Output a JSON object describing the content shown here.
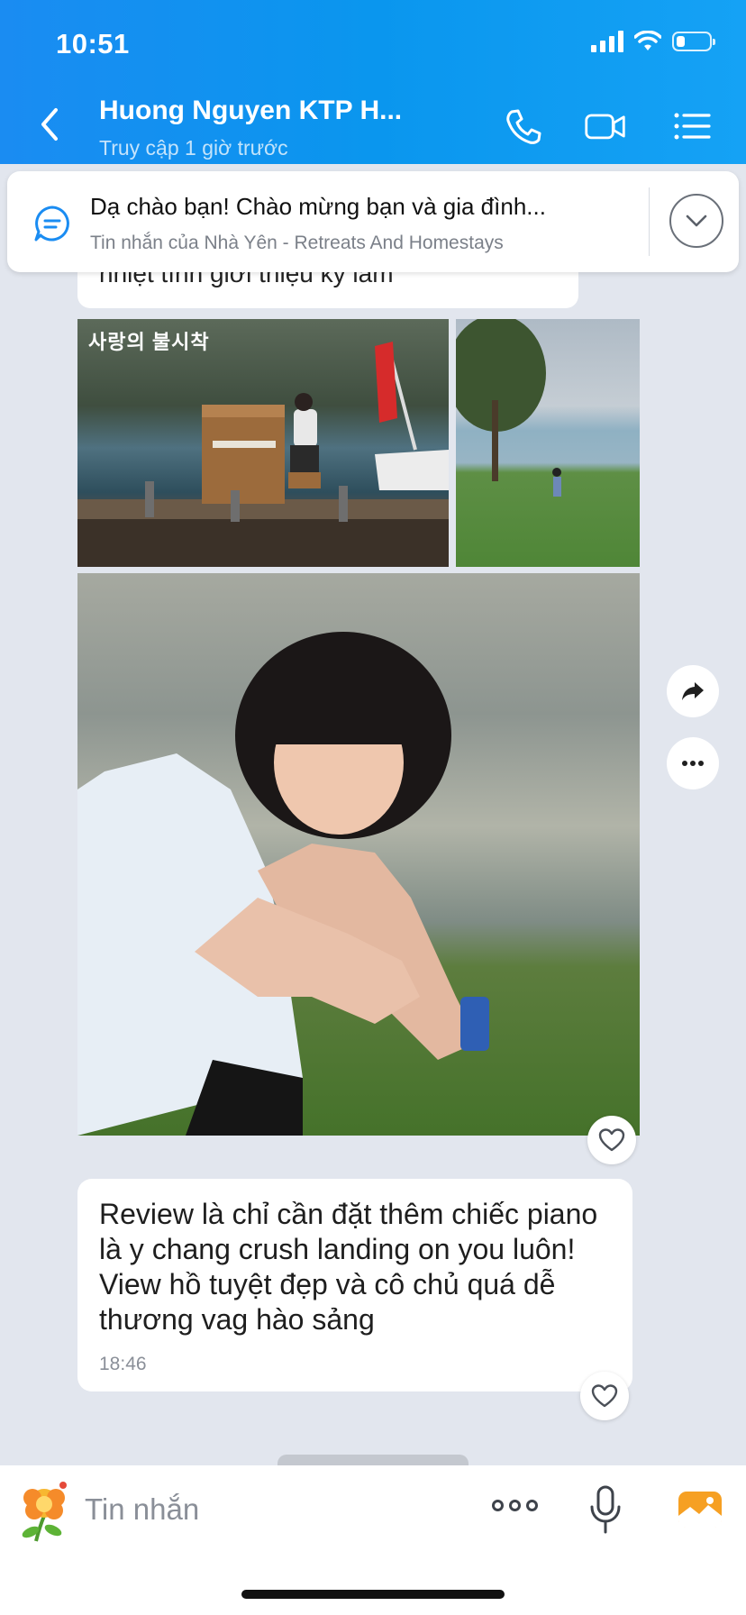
{
  "status_bar": {
    "time": "10:51"
  },
  "header": {
    "title": "Huong Nguyen KTP H...",
    "subtitle": "Truy cập 1 giờ trước"
  },
  "pinned_message": {
    "text": "Dạ chào bạn! Chào mừng bạn và gia đình...",
    "source": "Tin nhắn của Nhà Yên - Retreats And Homestays"
  },
  "previous_message": {
    "text": "nhiệt tình giới thiệu kỹ lắm"
  },
  "photos": {
    "piano_caption": "사랑의 불시착"
  },
  "message": {
    "text": "Review là chỉ cần đặt thêm chiếc piano là y chang crush landing on you luôn! View hồ tuyệt đẹp và cô chủ quá dễ thương vag hào sảng",
    "time": "18:46"
  },
  "composer": {
    "placeholder": "Tin nhắn"
  },
  "colors": {
    "header": "#1a8cf2",
    "background": "#e2e6ee",
    "image_button": "#f6a023"
  }
}
